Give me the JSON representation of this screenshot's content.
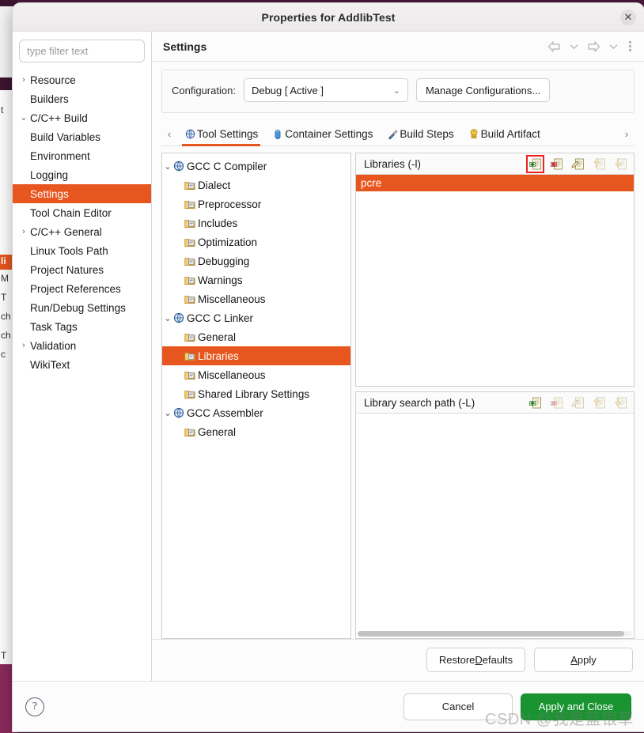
{
  "window": {
    "title": "Properties for AddlibTest",
    "close_label": "✕"
  },
  "sidebar": {
    "filter_placeholder": "type filter text",
    "filter_value": "",
    "items": [
      {
        "label": "Resource",
        "level": 0,
        "arrow": "›",
        "selected": false
      },
      {
        "label": "Builders",
        "level": 0,
        "arrow": "",
        "selected": false
      },
      {
        "label": "C/C++ Build",
        "level": 0,
        "arrow": "⌄",
        "selected": false
      },
      {
        "label": "Build Variables",
        "level": 1,
        "arrow": "",
        "selected": false
      },
      {
        "label": "Environment",
        "level": 1,
        "arrow": "",
        "selected": false
      },
      {
        "label": "Logging",
        "level": 1,
        "arrow": "",
        "selected": false
      },
      {
        "label": "Settings",
        "level": 1,
        "arrow": "",
        "selected": true
      },
      {
        "label": "Tool Chain Editor",
        "level": 1,
        "arrow": "",
        "selected": false
      },
      {
        "label": "C/C++ General",
        "level": 0,
        "arrow": "›",
        "selected": false
      },
      {
        "label": "Linux Tools Path",
        "level": 0,
        "arrow": "",
        "selected": false
      },
      {
        "label": "Project Natures",
        "level": 0,
        "arrow": "",
        "selected": false
      },
      {
        "label": "Project References",
        "level": 0,
        "arrow": "",
        "selected": false
      },
      {
        "label": "Run/Debug Settings",
        "level": 0,
        "arrow": "",
        "selected": false
      },
      {
        "label": "Task Tags",
        "level": 0,
        "arrow": "",
        "selected": false
      },
      {
        "label": "Validation",
        "level": 0,
        "arrow": "›",
        "selected": false
      },
      {
        "label": "WikiText",
        "level": 0,
        "arrow": "",
        "selected": false
      }
    ]
  },
  "content": {
    "page_title": "Settings",
    "nav": {
      "back_icon": "back-arrow-icon",
      "back_menu_icon": "chevron-down-icon",
      "forward_icon": "forward-arrow-icon",
      "forward_menu_icon": "chevron-down-icon",
      "overflow_icon": "kebab-menu-icon"
    },
    "configuration": {
      "label": "Configuration:",
      "selected": "Debug  [ Active ]",
      "options": [
        "Debug  [ Active ]"
      ],
      "manage_button": "Manage Configurations..."
    },
    "tabs": {
      "scroll_left": "‹",
      "scroll_right": "›",
      "items": [
        {
          "label": "Tool Settings",
          "icon": "tool-settings-icon",
          "active": true
        },
        {
          "label": "Container Settings",
          "icon": "container-icon",
          "active": false
        },
        {
          "label": "Build Steps",
          "icon": "build-steps-icon",
          "active": false
        },
        {
          "label": "Build Artifact",
          "icon": "build-artifact-icon",
          "active": false
        }
      ]
    },
    "tool_tree": [
      {
        "label": "GCC C Compiler",
        "type": "tool",
        "arrow": "⌄",
        "selected": false
      },
      {
        "label": "Dialect",
        "type": "option",
        "arrow": "",
        "selected": false
      },
      {
        "label": "Preprocessor",
        "type": "option",
        "arrow": "",
        "selected": false
      },
      {
        "label": "Includes",
        "type": "option",
        "arrow": "",
        "selected": false
      },
      {
        "label": "Optimization",
        "type": "option",
        "arrow": "",
        "selected": false
      },
      {
        "label": "Debugging",
        "type": "option",
        "arrow": "",
        "selected": false
      },
      {
        "label": "Warnings",
        "type": "option",
        "arrow": "",
        "selected": false
      },
      {
        "label": "Miscellaneous",
        "type": "option",
        "arrow": "",
        "selected": false
      },
      {
        "label": "GCC C Linker",
        "type": "tool",
        "arrow": "⌄",
        "selected": false
      },
      {
        "label": "General",
        "type": "option",
        "arrow": "",
        "selected": false
      },
      {
        "label": "Libraries",
        "type": "option",
        "arrow": "",
        "selected": true
      },
      {
        "label": "Miscellaneous",
        "type": "option",
        "arrow": "",
        "selected": false
      },
      {
        "label": "Shared Library Settings",
        "type": "option",
        "arrow": "",
        "selected": false
      },
      {
        "label": "GCC Assembler",
        "type": "tool",
        "arrow": "⌄",
        "selected": false
      },
      {
        "label": "General",
        "type": "option",
        "arrow": "",
        "selected": false
      }
    ],
    "libraries_pane": {
      "title": "Libraries (-l)",
      "tools": [
        {
          "name": "add-icon",
          "enabled": true,
          "highlighted": true
        },
        {
          "name": "delete-icon",
          "enabled": true,
          "highlighted": false
        },
        {
          "name": "edit-icon",
          "enabled": true,
          "highlighted": false
        },
        {
          "name": "move-up-icon",
          "enabled": false,
          "highlighted": false
        },
        {
          "name": "move-down-icon",
          "enabled": false,
          "highlighted": false
        }
      ],
      "entries": [
        {
          "value": "pcre",
          "selected": true
        }
      ]
    },
    "search_path_pane": {
      "title": "Library search path (-L)",
      "tools": [
        {
          "name": "add-icon",
          "enabled": true,
          "highlighted": false
        },
        {
          "name": "delete-icon",
          "enabled": false,
          "highlighted": false
        },
        {
          "name": "edit-icon",
          "enabled": false,
          "highlighted": false
        },
        {
          "name": "move-up-icon",
          "enabled": false,
          "highlighted": false
        },
        {
          "name": "move-down-icon",
          "enabled": false,
          "highlighted": false
        }
      ],
      "entries": []
    },
    "apply_bar": {
      "restore_defaults_pre": "Restore ",
      "restore_defaults_key": "D",
      "restore_defaults_post": "efaults",
      "apply_key": "A",
      "apply_post": "pply"
    }
  },
  "footer": {
    "help_icon": "help-question-icon",
    "cancel_label": "Cancel",
    "primary_label": "Apply and Close"
  },
  "background": {
    "strip_labels": [
      "t",
      "li",
      "M",
      "T",
      "ch",
      "ch",
      "c",
      "T"
    ]
  },
  "watermark": "CSDN @我是蓝银草",
  "colors": {
    "accent_orange": "#e8561f",
    "primary_green": "#1a9431",
    "highlight_red": "#ef2020",
    "desktop_purple": "#4a1638"
  }
}
